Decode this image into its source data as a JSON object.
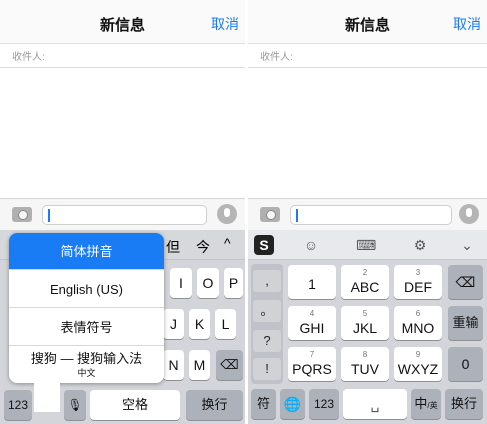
{
  "left": {
    "header": {
      "title": "新信息",
      "cancel": "取消"
    },
    "to_label": "收件人:",
    "popup": {
      "items": [
        "简体拼音",
        "English (US)",
        "表情符号",
        "搜狗 — 搜狗输入法"
      ],
      "item4_sub": "中文",
      "selected_index": 0
    },
    "keyboard": {
      "top_visible": [
        "但",
        "今",
        "^"
      ],
      "row2_visible": [
        "I",
        "O",
        "P"
      ],
      "row3_visible": [
        "J",
        "K",
        "L"
      ],
      "row4_visible": [
        "N",
        "M"
      ],
      "bottom": {
        "numbers": "123",
        "space": "空格",
        "return": "换行"
      }
    }
  },
  "right": {
    "header": {
      "title": "新信息",
      "cancel": "取消"
    },
    "to_label": "收件人:",
    "toolbar": {
      "logo": "S",
      "icons": [
        "smile-icon",
        "keyboard-icon",
        "gear-icon",
        "chevron-down-icon"
      ]
    },
    "side_keys": [
      ",",
      "。",
      "?",
      "!"
    ],
    "keys": [
      {
        "num": "1",
        "label": ""
      },
      {
        "num": "2",
        "label": "ABC"
      },
      {
        "num": "3",
        "label": "DEF"
      },
      {
        "num": "4",
        "label": "GHI"
      },
      {
        "num": "5",
        "label": "JKL"
      },
      {
        "num": "6",
        "label": "MNO"
      },
      {
        "num": "7",
        "label": "PQRS"
      },
      {
        "num": "8",
        "label": "TUV"
      },
      {
        "num": "9",
        "label": "WXYZ"
      }
    ],
    "key1_main": "1",
    "right_column": {
      "delete": "⌫",
      "reenter": "重输",
      "zero": "0"
    },
    "bottom": {
      "symbol": "符",
      "numbers": "123",
      "space": "␣",
      "cn": "中",
      "cn_sub": "/英",
      "return": "换行"
    }
  },
  "colors": {
    "accent": "#1a7cf5",
    "keyboard_bg": "#d3d5da"
  }
}
